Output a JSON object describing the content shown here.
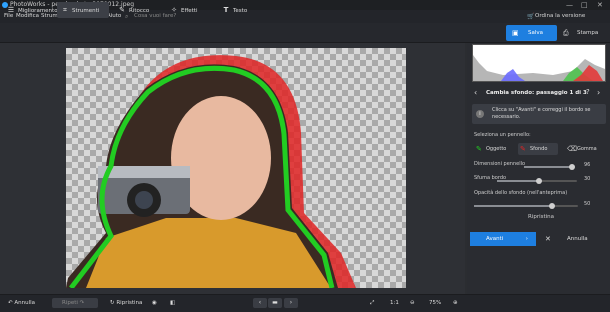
{
  "app": {
    "title": "PhotoWorks - pexels-photo-3979012.jpeg"
  },
  "window_controls": {
    "minimize": "—",
    "maximize": "□",
    "close": "✕"
  },
  "menu": {
    "items": [
      "File",
      "Modifica",
      "Strumenti",
      "Filtri",
      "Vista",
      "Aiuto"
    ],
    "search_placeholder": "Cosa vuoi fare?",
    "order_label": "Ordina la versione completa"
  },
  "toolbar": {
    "tabs": [
      {
        "label": "Miglioramento",
        "icon": "sliders-icon"
      },
      {
        "label": "Strumenti",
        "icon": "crop-icon",
        "active": true
      },
      {
        "label": "Ritocco",
        "icon": "brush-icon"
      },
      {
        "label": "Effetti",
        "icon": "magic-wand-icon"
      },
      {
        "label": "Testo",
        "icon": "text-icon"
      }
    ],
    "save_label": "Salva",
    "print_label": "Stampa"
  },
  "panel": {
    "step_title": "Cambia sfondo: passaggio 1 di 3",
    "hint": "Clicca su \"Avanti\" e correggi il bordo se necessario.",
    "select_brush_label": "Seleziona un pennello:",
    "brushes": [
      "Oggetto",
      "Sfondo",
      "Gomma"
    ],
    "brush_size_label": "Dimensioni pennello",
    "brush_size_value": 96,
    "feather_label": "Sfuma bordo",
    "feather_value": 30,
    "bg_opacity_label": "Opacità dello sfondo (nell'anteprima)",
    "bg_opacity_value": 50,
    "reset_label": "Ripristina",
    "next_label": "Avanti",
    "cancel_label": "Annulla"
  },
  "bottom": {
    "undo_label": "Annulla",
    "redo_label": "Ripeti",
    "restore_label": "Ripristina",
    "zoom_ratio": "1:1",
    "zoom_percent": "75%"
  },
  "colors": {
    "accent": "#1e7fe0",
    "object_brush": "#22cc22",
    "background_brush": "#e02424"
  }
}
